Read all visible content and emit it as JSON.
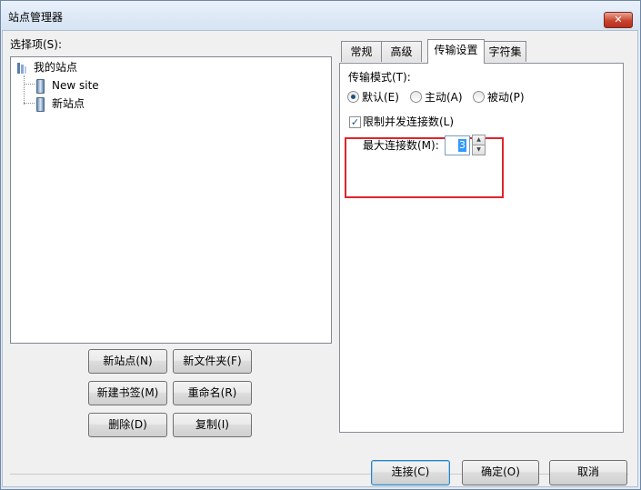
{
  "window": {
    "title": "站点管理器",
    "close_glyph": "✕"
  },
  "left": {
    "select_label": "选择项(S):",
    "tree": {
      "root": "我的站点",
      "children": [
        "New site",
        "新站点"
      ]
    },
    "buttons": {
      "new_site": "新站点(N)",
      "new_folder": "新文件夹(F)",
      "new_bookmark": "新建书签(M)",
      "rename": "重命名(R)",
      "delete": "删除(D)",
      "copy": "复制(I)"
    }
  },
  "tabs": [
    "常规",
    "高级",
    "传输设置",
    "字符集"
  ],
  "active_tab": "传输设置",
  "transfer": {
    "mode_label": "传输模式(T):",
    "modes": [
      {
        "label": "默认(E)",
        "selected": true
      },
      {
        "label": "主动(A)",
        "selected": false
      },
      {
        "label": "被动(P)",
        "selected": false
      }
    ],
    "limit_label": "限制并发连接数(L)",
    "limit_checked": true,
    "max_label": "最大连接数(M):",
    "max_value": "3"
  },
  "footer": {
    "connect": "连接(C)",
    "ok": "确定(O)",
    "cancel": "取消"
  },
  "colors": {
    "highlight_box": "#e0242c",
    "selection": "#3399ff"
  }
}
